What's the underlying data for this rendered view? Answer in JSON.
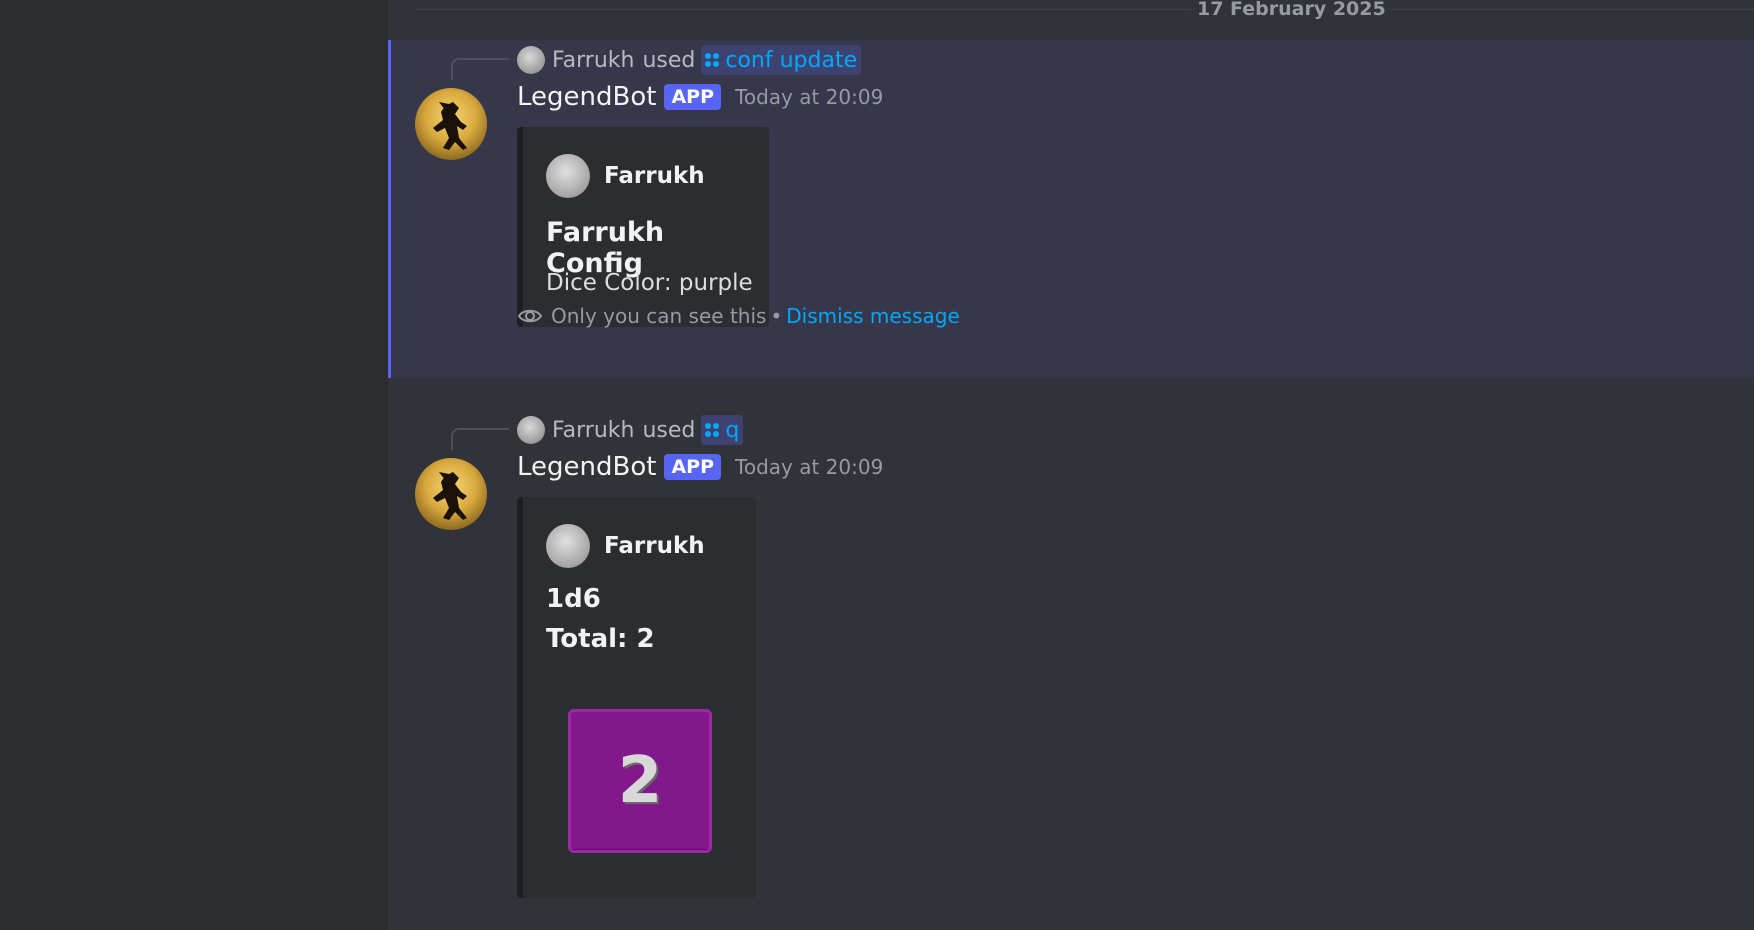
{
  "date_divider": "17 February 2025",
  "messages": [
    {
      "reply": {
        "user": "Farrukh",
        "used_text": "used",
        "command": "conf update"
      },
      "author": "LegendBot",
      "badge": "APP",
      "timestamp": "Today at 20:09",
      "embed": {
        "author": "Farrukh",
        "title": "Farrukh Config",
        "description": "Dice Color: purple"
      },
      "ephemeral": {
        "note": "Only you can see this",
        "separator": "•",
        "dismiss_label": "Dismiss message"
      }
    },
    {
      "reply": {
        "user": "Farrukh",
        "used_text": "used",
        "command": "q"
      },
      "author": "LegendBot",
      "badge": "APP",
      "timestamp": "Today at 20:09",
      "embed": {
        "author": "Farrukh",
        "title": "1d6",
        "subtitle": "Total: 2",
        "dice_value": "2",
        "dice_color": "#83178c"
      }
    }
  ],
  "colors": {
    "accent": "#5865f2",
    "link": "#00a8fc",
    "background": "#313338",
    "ephemeral_background": "#36374a"
  }
}
